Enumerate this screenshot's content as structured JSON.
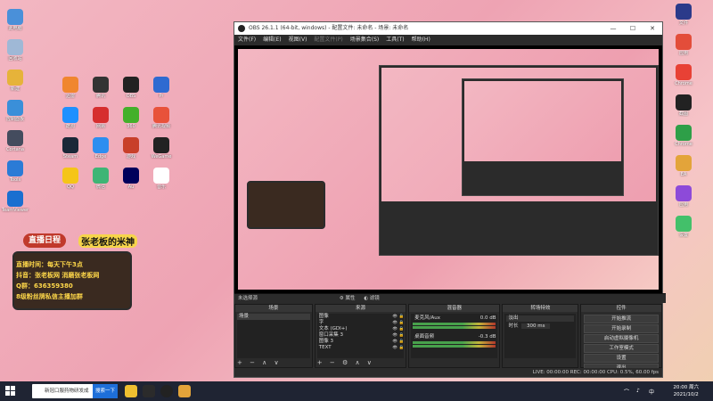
{
  "desktop": {
    "left_icons": [
      {
        "label": "此电脑",
        "color": "#4a90d9"
      },
      {
        "label": "回收站",
        "color": "#9fb8d6"
      },
      {
        "label": "新建",
        "color": "#e6b33a"
      },
      {
        "label": "控制面板",
        "color": "#3a8fd9"
      },
      {
        "label": "Cortana",
        "color": "#444c5e"
      },
      {
        "label": "Tools",
        "color": "#2b7bd6"
      },
      {
        "label": "TeamViewer",
        "color": "#1a6fd0"
      }
    ],
    "grid_icons": [
      {
        "label": "迅雷",
        "color": "#f0862f"
      },
      {
        "label": "腾讯",
        "color": "#333"
      },
      {
        "label": "OBS",
        "color": "#222"
      },
      {
        "label": "Pr",
        "color": "#2e6ad1"
      },
      {
        "label": "酷狗",
        "color": "#1e90ff"
      },
      {
        "label": "网易",
        "color": "#d62e2e"
      },
      {
        "label": "360",
        "color": "#43b02a"
      },
      {
        "label": "腾讯视频",
        "color": "#e8523a"
      },
      {
        "label": "Steam",
        "color": "#1b2838"
      },
      {
        "label": "Edge",
        "color": "#2d8ef0"
      },
      {
        "label": "游戏",
        "color": "#c83f2a"
      },
      {
        "label": "WeGame",
        "color": "#222"
      },
      {
        "label": "QQ",
        "color": "#f5c518"
      },
      {
        "label": "微信",
        "color": "#3eb575"
      },
      {
        "label": "Au",
        "color": "#00005b"
      },
      {
        "label": "音乐",
        "color": "#fff"
      }
    ],
    "right_icons": [
      {
        "label": "文件",
        "color": "#2b3a8a"
      },
      {
        "label": "应用",
        "color": "#e34d3a"
      },
      {
        "label": "Chrome",
        "color": "#e84135"
      },
      {
        "label": "截图",
        "color": "#222"
      },
      {
        "label": "Chrome",
        "color": "#2e9f48"
      },
      {
        "label": "EA",
        "color": "#e3a43a"
      },
      {
        "label": "应用",
        "color": "#8d4ad9"
      },
      {
        "label": "设置",
        "color": "#43c06a"
      }
    ]
  },
  "banner": {
    "header": "直播日程",
    "title": "张老板的米神",
    "lines": [
      "直播时间：每天下午3点",
      "抖音：张老板网 消磨张老板网",
      "Q群：636359380",
      "8级粉丝牌私信主播加群"
    ]
  },
  "obs": {
    "title": "OBS 26.1.1 (64-bit, windows) - 配置文件: 未命名 - 场景: 未命名",
    "menu": [
      "文件(F)",
      "编辑(E)",
      "视图(V)",
      "配置文件(P)",
      "场景集合(S)",
      "工具(T)",
      "帮助(H)"
    ],
    "menu_disabled_index": 3,
    "status_line": "未选择源",
    "props_button": "属性",
    "filters_button": "滤镜",
    "docks": {
      "scenes": {
        "title": "场景",
        "items": [
          "场景"
        ]
      },
      "sources": {
        "title": "来源",
        "items": [
          "图像",
          "字",
          "文本 (GDI+)",
          "窗口采集 3",
          "图像 3",
          "TEXT"
        ]
      },
      "mixer": {
        "title": "混音器",
        "channels": [
          {
            "name": "麦克风/Aux",
            "level": "0.0 dB"
          },
          {
            "name": "桌面音频",
            "level": "-0.3 dB"
          }
        ]
      },
      "transitions": {
        "title": "转场特效",
        "type": "淡出",
        "duration_label": "时长",
        "duration": "300 ms"
      },
      "controls": {
        "title": "控件",
        "buttons": [
          "开始推流",
          "开始录制",
          "启动虚拟摄像机",
          "工作室模式",
          "设置",
          "退出"
        ]
      }
    },
    "bottom_status": "LIVE: 00:00:00    REC: 00:00:00    CPU: 0.5%, 60.00 fps"
  },
  "taskbar": {
    "search_text": "新冠口服药物研发成",
    "search_button": "搜索一下",
    "clock_time": "20:00 周六",
    "clock_date": "2021/10/2"
  }
}
